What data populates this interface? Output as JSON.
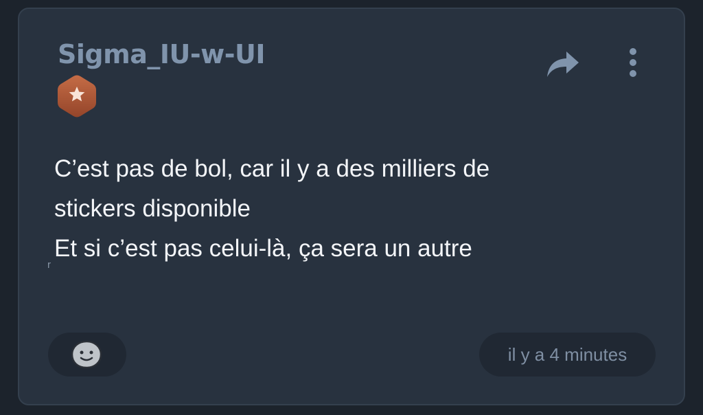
{
  "post": {
    "username": "Sigma_IU-w-UI",
    "message_lines": [
      "C’est pas de bol, car il y a des milliers de",
      "stickers disponible",
      "Et si c’est pas celui-là, ça sera un autre"
    ],
    "stray_mark": "r",
    "timestamp": "il y a 4 minutes"
  },
  "icons": {
    "badge": "star-hexagon-badge-icon",
    "share": "share-arrow-icon",
    "more": "more-vertical-icon",
    "reaction": "emoji-face-icon"
  },
  "colors": {
    "background": "#1c232c",
    "card": "#28323f",
    "username": "#8094ac",
    "badge": "#b45f3c",
    "message_text": "#f3f5f8",
    "timestamp_text": "#7f8fa3"
  }
}
